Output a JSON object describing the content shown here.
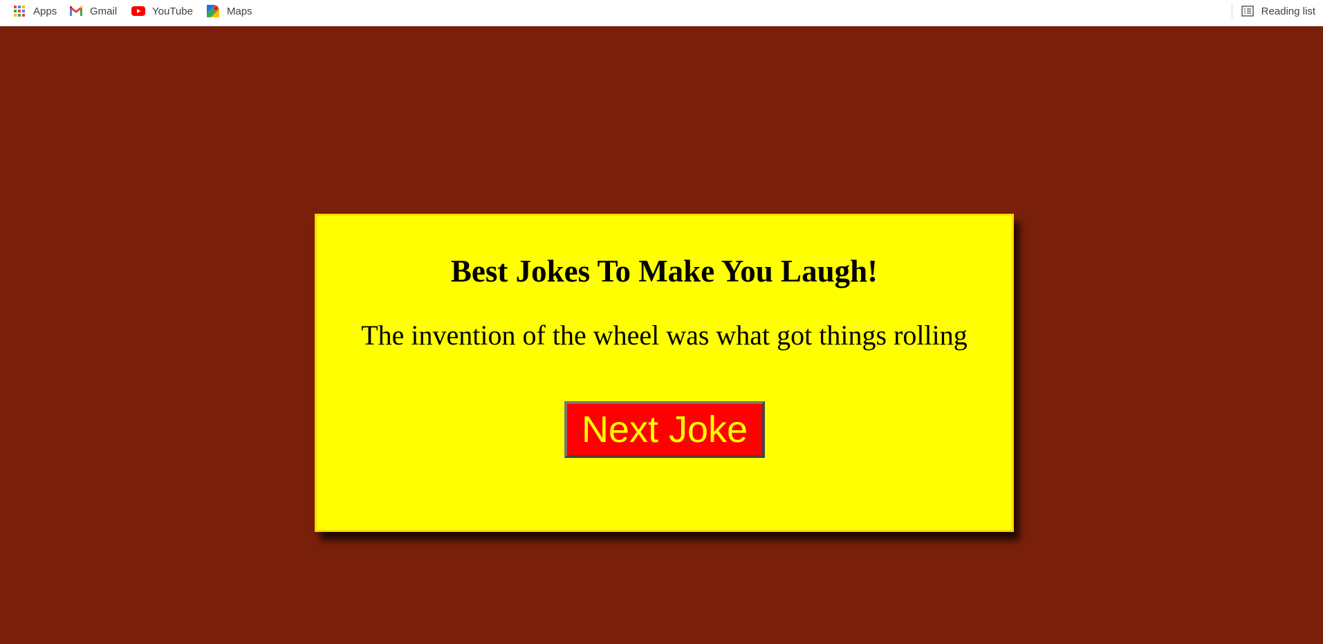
{
  "bookmarks": [
    {
      "label": "Apps",
      "icon": "apps-grid-icon"
    },
    {
      "label": "Gmail",
      "icon": "gmail-icon"
    },
    {
      "label": "YouTube",
      "icon": "youtube-icon"
    },
    {
      "label": "Maps",
      "icon": "maps-icon"
    }
  ],
  "reading_list": {
    "label": "Reading list",
    "icon": "reading-list-icon"
  },
  "joke_card": {
    "title": "Best Jokes To Make You Laugh!",
    "joke": "The invention of the wheel was what got things rolling",
    "button_label": "Next Joke"
  },
  "colors": {
    "page_background": "#7a200a",
    "card_background": "#ffff00",
    "card_border": "#ffd700",
    "button_background": "#ff0000",
    "button_text": "#ffff00"
  }
}
